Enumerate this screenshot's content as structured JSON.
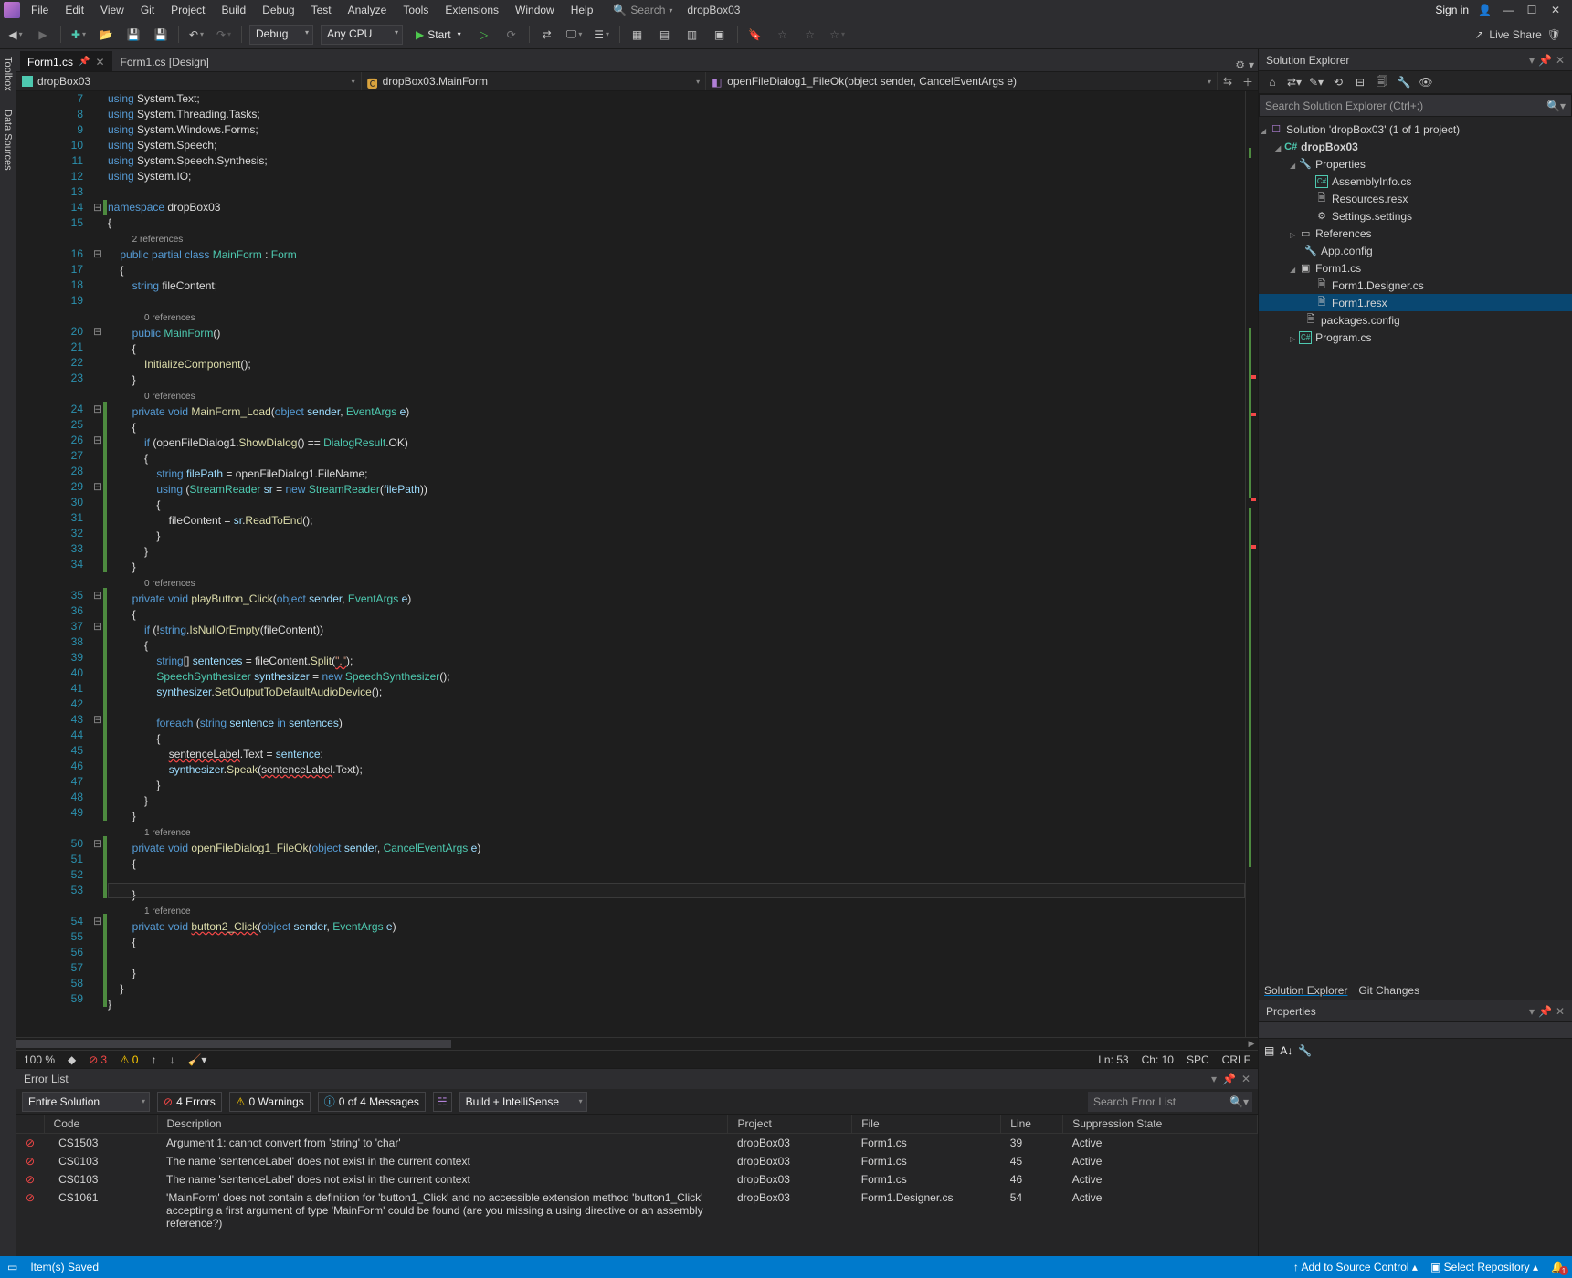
{
  "menu": [
    "File",
    "Edit",
    "View",
    "Git",
    "Project",
    "Build",
    "Debug",
    "Test",
    "Analyze",
    "Tools",
    "Extensions",
    "Window",
    "Help"
  ],
  "search_placeholder": "Search",
  "solution_name_title": "dropBox03",
  "signin": "Sign in",
  "liveshare": "Live Share",
  "toolbar": {
    "config": "Debug",
    "platform": "Any CPU",
    "start": "Start"
  },
  "tabs": [
    {
      "label": "Form1.cs",
      "active": true
    },
    {
      "label": "Form1.cs [Design]",
      "active": false
    }
  ],
  "nav": {
    "left": "dropBox03",
    "mid": "dropBox03.MainForm",
    "right": "openFileDialog1_FileOk(object sender, CancelEventArgs e)"
  },
  "editor_status": {
    "zoom": "100 %",
    "errors": "3",
    "warnings": "0",
    "ln": "Ln: 53",
    "ch": "Ch: 10",
    "ins": "SPC",
    "eol": "CRLF"
  },
  "solution_explorer": {
    "title": "Solution Explorer",
    "search_placeholder": "Search Solution Explorer (Ctrl+;)",
    "solution": "Solution 'dropBox03' (1 of 1 project)",
    "project": "dropBox03",
    "nodes": {
      "properties": "Properties",
      "assemblyinfo": "AssemblyInfo.cs",
      "resources": "Resources.resx",
      "settings": "Settings.settings",
      "references": "References",
      "appconfig": "App.config",
      "form1": "Form1.cs",
      "form1designer": "Form1.Designer.cs",
      "form1resx": "Form1.resx",
      "packages": "packages.config",
      "program": "Program.cs"
    },
    "bottom_tabs": [
      "Solution Explorer",
      "Git Changes"
    ]
  },
  "properties_title": "Properties",
  "errorlist": {
    "title": "Error List",
    "scope": "Entire Solution",
    "counts": {
      "errors": "4 Errors",
      "warnings": "0 Warnings",
      "messages": "0 of 4 Messages"
    },
    "build_combo": "Build + IntelliSense",
    "search_placeholder": "Search Error List",
    "columns": [
      "",
      "Code",
      "Description",
      "Project",
      "File",
      "Line",
      "Suppression State"
    ],
    "rows": [
      {
        "code": "CS1503",
        "desc": "Argument 1: cannot convert from 'string' to 'char'",
        "project": "dropBox03",
        "file": "Form1.cs",
        "line": "39",
        "state": "Active"
      },
      {
        "code": "CS0103",
        "desc": "The name 'sentenceLabel' does not exist in the current context",
        "project": "dropBox03",
        "file": "Form1.cs",
        "line": "45",
        "state": "Active"
      },
      {
        "code": "CS0103",
        "desc": "The name 'sentenceLabel' does not exist in the current context",
        "project": "dropBox03",
        "file": "Form1.cs",
        "line": "46",
        "state": "Active"
      },
      {
        "code": "CS1061",
        "desc": "'MainForm' does not contain a definition for 'button1_Click' and no accessible extension method 'button1_Click' accepting a first argument of type 'MainForm' could be found (are you missing a using directive or an assembly reference?)",
        "project": "dropBox03",
        "file": "Form1.Designer.cs",
        "line": "54",
        "state": "Active"
      }
    ]
  },
  "statusbar": {
    "left": "Item(s) Saved",
    "source_control": "Add to Source Control",
    "repo": "Select Repository"
  },
  "siderail": [
    "Toolbox",
    "Data Sources"
  ],
  "code": {
    "first_line_no": 7,
    "refs": {
      "two": "2 references",
      "zero": "0 references",
      "one": "1 reference"
    },
    "lines": [
      "using System.Text;",
      "using System.Threading.Tasks;",
      "using System.Windows.Forms;",
      "using System.Speech;",
      "using System.Speech.Synthesis;",
      "using System.IO;"
    ]
  }
}
